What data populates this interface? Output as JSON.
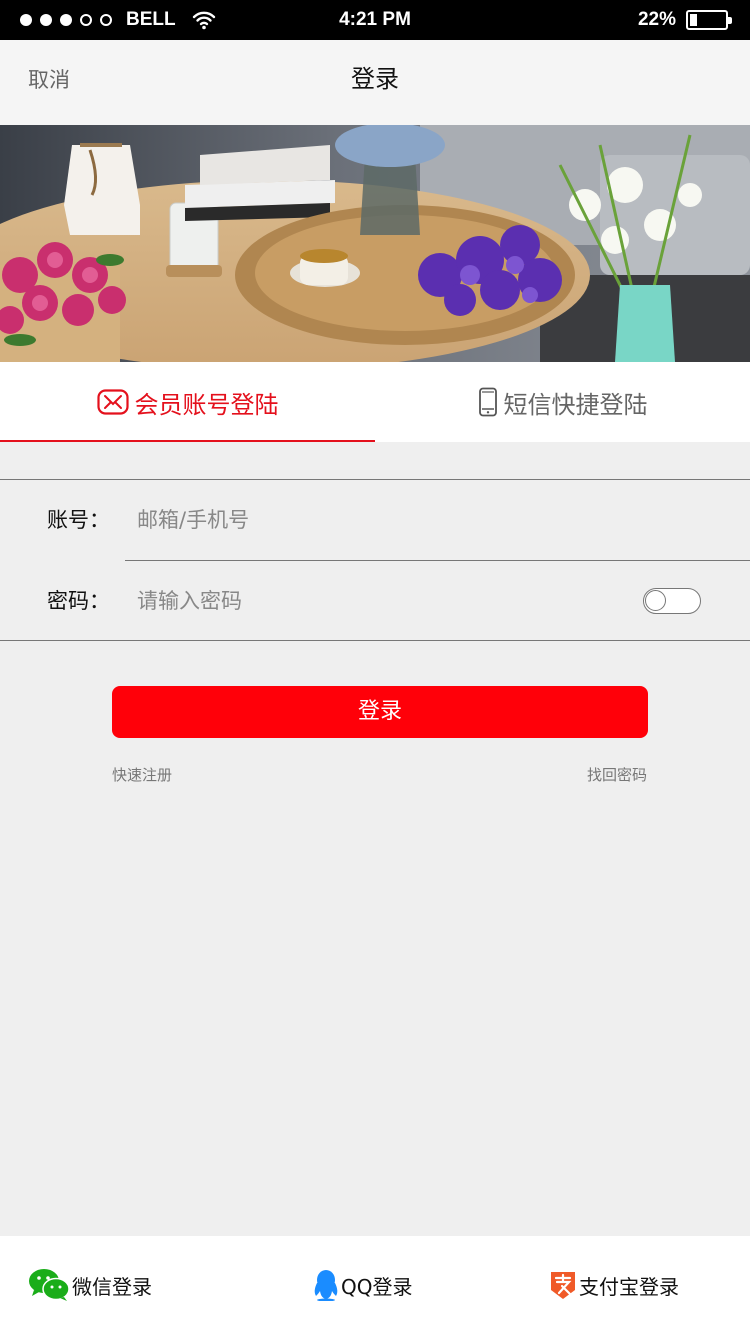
{
  "status_bar": {
    "carrier": "BELL",
    "time": "4:21 PM",
    "battery_text": "22%",
    "battery_level": 0.22
  },
  "nav": {
    "cancel_label": "取消",
    "title": "登录"
  },
  "tabs": [
    {
      "label": "会员账号登陆",
      "active": true
    },
    {
      "label": "短信快捷登陆",
      "active": false
    }
  ],
  "form": {
    "account_label": "账号：",
    "account_placeholder": "邮箱/手机号",
    "password_label": "密码：",
    "password_placeholder": "请输入密码"
  },
  "actions": {
    "login_label": "登录",
    "register_label": "快速注册",
    "forgot_label": "找回密码"
  },
  "social": [
    {
      "label": "微信登录",
      "icon": "wechat-icon",
      "color": "#1aad19"
    },
    {
      "label": "QQ登录",
      "icon": "qq-icon",
      "color": "#1a8cff"
    },
    {
      "label": "支付宝登录",
      "icon": "alipay-icon",
      "color": "#f05a28"
    }
  ],
  "colors": {
    "accent": "#e4101c",
    "button": "#ff0009"
  }
}
